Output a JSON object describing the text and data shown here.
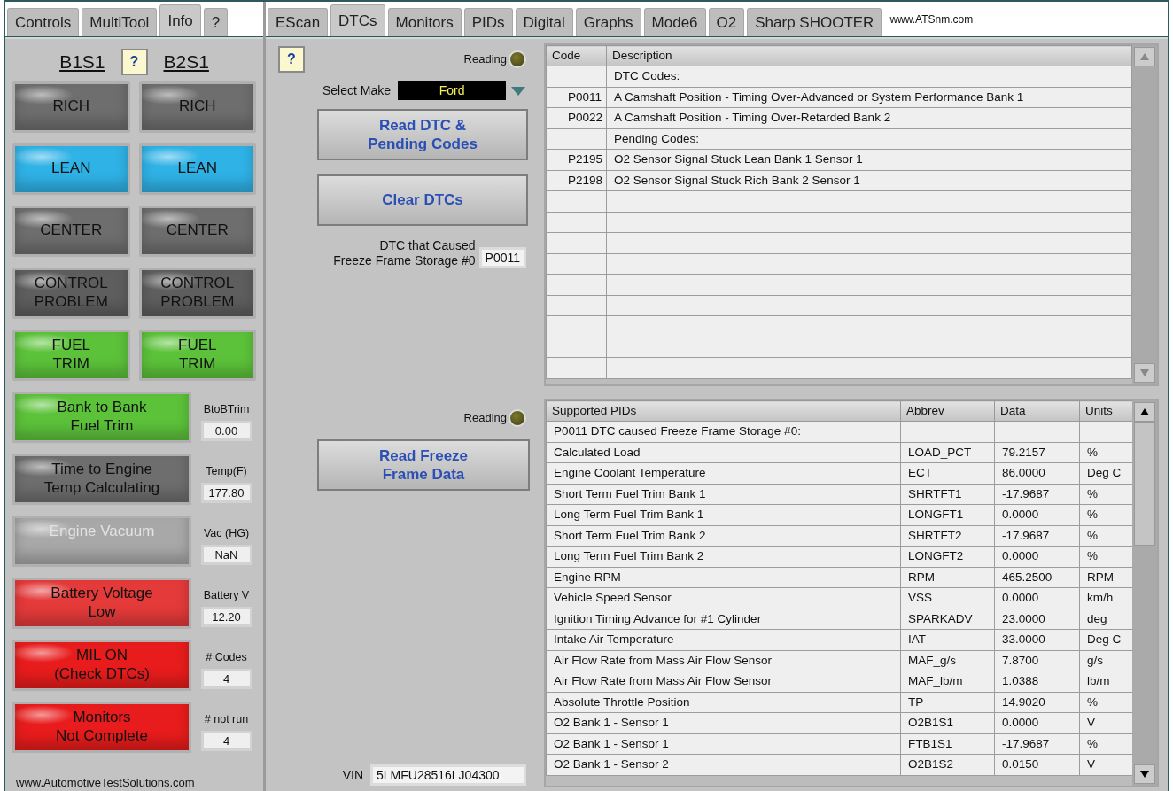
{
  "left_tabs": [
    {
      "label": "Controls",
      "selected": false
    },
    {
      "label": "MultiTool",
      "selected": false
    },
    {
      "label": "Info",
      "selected": true
    },
    {
      "label": "?",
      "selected": false
    }
  ],
  "sensor_headers": [
    "B1S1",
    "?",
    "B2S1"
  ],
  "indicators": [
    {
      "label": [
        "RICH"
      ],
      "color": "#6e6e6e",
      "disabled": false
    },
    {
      "label": [
        "RICH"
      ],
      "color": "#6e6e6e",
      "disabled": false
    },
    {
      "label": [
        "LEAN"
      ],
      "color": "#2fb2e6",
      "disabled": false
    },
    {
      "label": [
        "LEAN"
      ],
      "color": "#2fb2e6",
      "disabled": false
    },
    {
      "label": [
        "CENTER"
      ],
      "color": "#6e6e6e",
      "disabled": false
    },
    {
      "label": [
        "CENTER"
      ],
      "color": "#6e6e6e",
      "disabled": false
    },
    {
      "label": [
        "CONTROL",
        "PROBLEM"
      ],
      "color": "#5e5e5e",
      "disabled": false
    },
    {
      "label": [
        "CONTROL",
        "PROBLEM"
      ],
      "color": "#5e5e5e",
      "disabled": false
    },
    {
      "label": [
        "FUEL",
        "TRIM"
      ],
      "color": "#5cc23a",
      "disabled": false
    },
    {
      "label": [
        "FUEL",
        "TRIM"
      ],
      "color": "#5cc23a",
      "disabled": false
    }
  ],
  "status_rows": [
    {
      "label": [
        "Bank to Bank",
        "Fuel Trim"
      ],
      "color": "#5cc23a",
      "disabled": false,
      "caption": "BtoBTrim",
      "value": "0.00"
    },
    {
      "label": [
        "Time to Engine",
        "Temp Calculating"
      ],
      "color": "#6e6e6e",
      "disabled": false,
      "caption": "Temp(F)",
      "value": "177.80"
    },
    {
      "label": [
        "Engine Vacuum"
      ],
      "color": "#a8a8a8",
      "disabled": true,
      "caption": "Vac (HG)",
      "value": "NaN"
    },
    {
      "label": [
        "Battery Voltage",
        "Low"
      ],
      "color": "#e43a3a",
      "disabled": false,
      "caption": "Battery V",
      "value": "12.20"
    },
    {
      "label": [
        "MIL ON",
        "(Check DTCs)"
      ],
      "color": "#e81c1c",
      "disabled": false,
      "caption": "# Codes",
      "value": "4"
    },
    {
      "label": [
        "Monitors",
        "Not Complete"
      ],
      "color": "#e81c1c",
      "disabled": false,
      "caption": "# not run",
      "value": "4"
    }
  ],
  "footer": "www.AutomotiveTestSolutions.com",
  "right_tabs": [
    {
      "label": "EScan",
      "selected": false
    },
    {
      "label": "DTCs",
      "selected": true
    },
    {
      "label": "Monitors",
      "selected": false
    },
    {
      "label": "PIDs",
      "selected": false
    },
    {
      "label": "Digital",
      "selected": false
    },
    {
      "label": "Graphs",
      "selected": false
    },
    {
      "label": "Mode6",
      "selected": false
    },
    {
      "label": "O2",
      "selected": false
    },
    {
      "label": "Sharp SHOOTER",
      "selected": false
    }
  ],
  "website": "www.ATSnm.com",
  "dtc_panel": {
    "help": "?",
    "reading": {
      "label": "Reading",
      "on": false
    },
    "make_label": "Select Make",
    "make": "Ford",
    "read_button": [
      "Read DTC &",
      "Pending Codes"
    ],
    "clear_button": [
      "Clear DTCs"
    ],
    "freeze_label": [
      "DTC that Caused",
      "Freeze Frame Storage #0"
    ],
    "freeze_code": "P0011"
  },
  "dtc_table": {
    "columns": [
      "Code",
      "Description"
    ],
    "rows": [
      [
        "",
        "DTC Codes:"
      ],
      [
        "P0011",
        "A Camshaft Position - Timing Over-Advanced or System Performance Bank 1"
      ],
      [
        "P0022",
        "A Camshaft Position - Timing Over-Retarded Bank 2"
      ],
      [
        "",
        "Pending Codes:"
      ],
      [
        "P2195",
        "O2 Sensor Signal Stuck Lean Bank 1 Sensor 1"
      ],
      [
        "P2198",
        "O2 Sensor Signal Stuck Rich Bank 2 Sensor 1"
      ]
    ]
  },
  "freeze_panel": {
    "reading": {
      "label": "Reading",
      "on": false
    },
    "read_button": [
      "Read Freeze",
      "Frame Data"
    ],
    "vin_label": "VIN",
    "vin": "5LMFU28516LJ04300"
  },
  "pid_table": {
    "columns": [
      "Supported PIDs",
      "Abbrev",
      "Data",
      "Units"
    ],
    "rows": [
      [
        "P0011 DTC caused Freeze Frame Storage #0:",
        "",
        "",
        ""
      ],
      [
        "Calculated Load",
        "LOAD_PCT",
        "79.2157",
        "%"
      ],
      [
        "Engine Coolant Temperature",
        "ECT",
        "86.0000",
        "Deg C"
      ],
      [
        "Short Term Fuel Trim Bank 1",
        "SHRTFT1",
        "-17.9687",
        "%"
      ],
      [
        "Long Term Fuel Trim Bank 1",
        "LONGFT1",
        "0.0000",
        "%"
      ],
      [
        "Short Term Fuel Trim Bank 2",
        "SHRTFT2",
        "-17.9687",
        "%"
      ],
      [
        "Long Term Fuel Trim Bank 2",
        "LONGFT2",
        "0.0000",
        "%"
      ],
      [
        "Engine RPM",
        "RPM",
        "465.2500",
        "RPM"
      ],
      [
        "Vehicle Speed Sensor",
        "VSS",
        "0.0000",
        "km/h"
      ],
      [
        "Ignition Timing Advance for #1 Cylinder",
        "SPARKADV",
        "23.0000",
        "deg"
      ],
      [
        "Intake Air Temperature",
        "IAT",
        "33.0000",
        "Deg C"
      ],
      [
        "Air Flow Rate from Mass Air Flow Sensor",
        "MAF_g/s",
        "7.8700",
        "g/s"
      ],
      [
        "Air Flow Rate from Mass Air Flow Sensor",
        "MAF_lb/m",
        "1.0388",
        "lb/m"
      ],
      [
        "Absolute Throttle Position",
        "TP",
        "14.9020",
        "%"
      ],
      [
        "O2 Bank 1 - Sensor 1",
        "O2B1S1",
        "0.0000",
        "V"
      ],
      [
        "O2 Bank 1 - Sensor 1",
        "FTB1S1",
        "-17.9687",
        "%"
      ],
      [
        "O2 Bank 1 - Sensor 2",
        "O2B1S2",
        "0.0150",
        "V"
      ]
    ]
  }
}
